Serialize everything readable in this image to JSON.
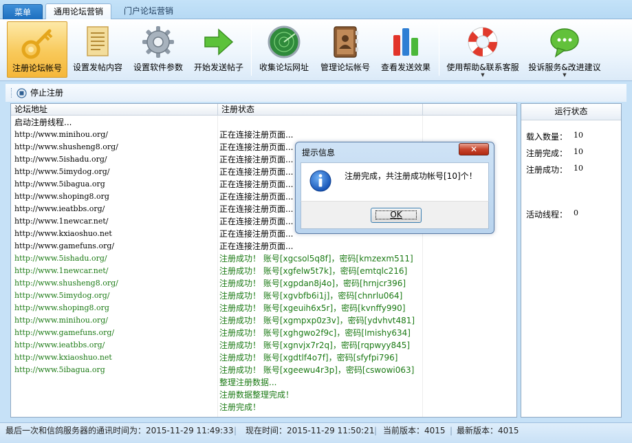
{
  "tabs": {
    "menu": "菜单",
    "general": "通用论坛营销",
    "portal": "门户论坛营销"
  },
  "ribbon": [
    {
      "label": "注册论坛帐号",
      "icon": "key-icon",
      "active": true,
      "dropdown": false
    },
    {
      "label": "设置发帖内容",
      "icon": "document-icon",
      "active": false,
      "dropdown": false
    },
    {
      "label": "设置软件参数",
      "icon": "gear-icon",
      "active": false,
      "dropdown": false
    },
    {
      "label": "开始发送帖子",
      "icon": "arrow-right-icon",
      "active": false,
      "dropdown": false
    },
    {
      "label": "收集论坛网址",
      "icon": "radar-icon",
      "active": false,
      "dropdown": false
    },
    {
      "label": "管理论坛帐号",
      "icon": "address-book-icon",
      "active": false,
      "dropdown": false
    },
    {
      "label": "查看发送效果",
      "icon": "bar-chart-icon",
      "active": false,
      "dropdown": false
    },
    {
      "label": "使用帮助&联系客服",
      "icon": "lifebuoy-icon",
      "active": false,
      "dropdown": true
    },
    {
      "label": "投诉服务&改进建议",
      "icon": "chat-bubble-icon",
      "active": false,
      "dropdown": true
    }
  ],
  "subtoolbar": {
    "stop_label": "停止注册"
  },
  "grid": {
    "columns": [
      "论坛地址",
      "注册状态"
    ],
    "rows": [
      {
        "url": "启动注册线程...",
        "status": "",
        "green": false,
        "cjk_url": true
      },
      {
        "url": "http://www.minihou.org/",
        "status": "正在连接注册页面...",
        "green": false
      },
      {
        "url": "http://www.shusheng8.org/",
        "status": "正在连接注册页面...",
        "green": false
      },
      {
        "url": "http://www.5ishadu.org/",
        "status": "正在连接注册页面...",
        "green": false
      },
      {
        "url": "http://www.5imydog.org/",
        "status": "正在连接注册页面...",
        "green": false
      },
      {
        "url": "http://www.5ibagua.org",
        "status": "正在连接注册页面...",
        "green": false
      },
      {
        "url": "http://www.shoping8.org",
        "status": "正在连接注册页面...",
        "green": false
      },
      {
        "url": "http://www.ieatbbs.org/",
        "status": "正在连接注册页面...",
        "green": false
      },
      {
        "url": "http://www.1newcar.net/",
        "status": "正在连接注册页面...",
        "green": false
      },
      {
        "url": "http://www.kxiaoshuo.net",
        "status": "正在连接注册页面...",
        "green": false
      },
      {
        "url": "http://www.gamefuns.org/",
        "status": "正在连接注册页面...",
        "green": false
      },
      {
        "url": "http://www.5ishadu.org/",
        "status": "注册成功！  账号[xgcsol5q8f]，密码[kmzexm511]",
        "green": true
      },
      {
        "url": "http://www.1newcar.net/",
        "status": "注册成功！  账号[xgfelw5t7k]，密码[emtqlc216]",
        "green": true
      },
      {
        "url": "http://www.shusheng8.org/",
        "status": "注册成功！  账号[xgpdan8j4o]，密码[hrnjcr396]",
        "green": true
      },
      {
        "url": "http://www.5imydog.org/",
        "status": "注册成功！  账号[xgvbfb6i1j]，密码[chnrlu064]",
        "green": true
      },
      {
        "url": "http://www.shoping8.org",
        "status": "注册成功！  账号[xgeuih6x5r]，密码[kvnffy990]",
        "green": true
      },
      {
        "url": "http://www.minihou.org/",
        "status": "注册成功！  账号[xgmpxp0z3v]，密码[ydvhvt481]",
        "green": true
      },
      {
        "url": "http://www.gamefuns.org/",
        "status": "注册成功！  账号[xghgwo2f9c]，密码[lmishy634]",
        "green": true
      },
      {
        "url": "http://www.ieatbbs.org/",
        "status": "注册成功！  账号[xgnvjx7r2q]，密码[rqpwyy845]",
        "green": true
      },
      {
        "url": "http://www.kxiaoshuo.net",
        "status": "注册成功！  账号[xgdtlf4o7f]，密码[sfyfpi796]",
        "green": true
      },
      {
        "url": "http://www.5ibagua.org",
        "status": "注册成功！  账号[xgeewu4r3p]，密码[cswowi063]",
        "green": true
      },
      {
        "url": "",
        "status": "整理注册数据...",
        "green": true
      },
      {
        "url": "",
        "status": "注册数据整理完成！",
        "green": true
      },
      {
        "url": "",
        "status": "注册完成！",
        "green": true
      }
    ]
  },
  "run_status": {
    "title": "运行状态",
    "loaded_label": "载入数量：",
    "loaded_value": "10",
    "done_label": "注册完成：",
    "done_value": "10",
    "success_label": "注册成功：",
    "success_value": "10",
    "threads_label": "活动线程：",
    "threads_value": "0"
  },
  "statusbar": {
    "last_comm": "最后一次和信鸽服务器的通讯时间为：2015-11-29 11:49:33",
    "now": "现在时间：2015-11-29 11:50:21",
    "current_version": "当前版本：4015",
    "latest_version": "最新版本：4015"
  },
  "dialog": {
    "title": "提示信息",
    "message": "注册完成，共注册成功帐号[10]个！",
    "ok": "OK",
    "close": "✕"
  },
  "colors": {
    "success_text": "#1b7a14",
    "active_button": "#f8c95a",
    "window_bg": "#c6e1f7"
  }
}
